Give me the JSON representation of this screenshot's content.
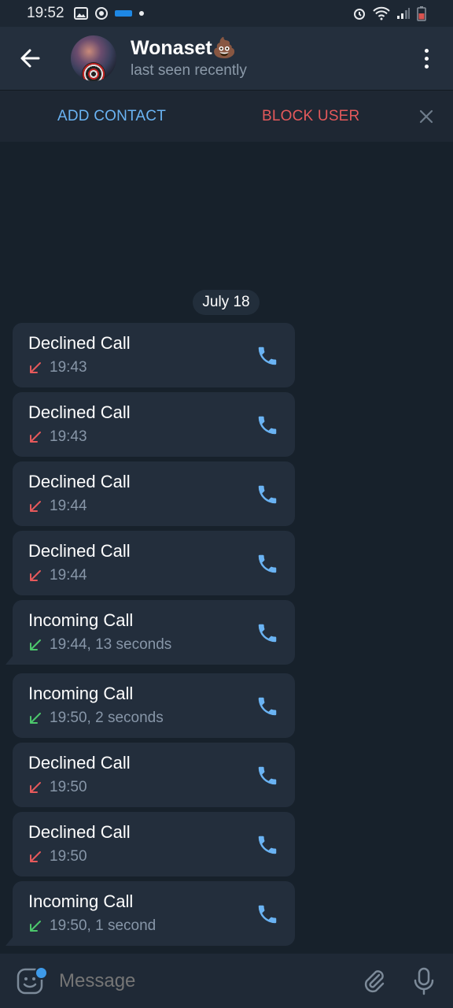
{
  "status_bar": {
    "time": "19:52",
    "icons_left": [
      "image-icon",
      "sync-icon",
      "webtoon-icon",
      "dot-icon"
    ],
    "icons_right": [
      "alarm-icon",
      "wifi-icon",
      "signal-icon",
      "battery-icon"
    ],
    "battery_color": "#d9534f"
  },
  "header": {
    "name": "Wonaset💩",
    "status": "last seen recently"
  },
  "action_bar": {
    "add_contact": "ADD CONTACT",
    "block_user": "BLOCK USER"
  },
  "date_separator": "July 18",
  "calls": [
    {
      "title": "Declined Call",
      "detail": "19:43",
      "direction": "declined"
    },
    {
      "title": "Declined Call",
      "detail": "19:43",
      "direction": "declined"
    },
    {
      "title": "Declined Call",
      "detail": "19:44",
      "direction": "declined"
    },
    {
      "title": "Declined Call",
      "detail": "19:44",
      "direction": "declined"
    },
    {
      "title": "Incoming Call",
      "detail": "19:44, 13 seconds",
      "direction": "incoming"
    },
    {
      "title": "Incoming Call",
      "detail": "19:50, 2 seconds",
      "direction": "incoming"
    },
    {
      "title": "Declined Call",
      "detail": "19:50",
      "direction": "declined"
    },
    {
      "title": "Declined Call",
      "detail": "19:50",
      "direction": "declined"
    },
    {
      "title": "Incoming Call",
      "detail": "19:50, 1 second",
      "direction": "incoming"
    }
  ],
  "composer": {
    "placeholder": "Message"
  },
  "colors": {
    "accent": "#6ab3f3",
    "declined": "#e5595b",
    "incoming": "#4cc76c",
    "background": "#17212b",
    "bubble": "#232e3c"
  }
}
